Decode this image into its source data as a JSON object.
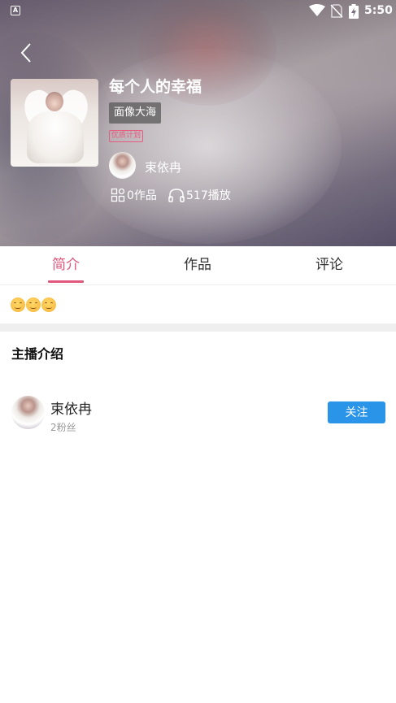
{
  "status_bar": {
    "time": "5:50",
    "icons": [
      "a-icon",
      "wifi-icon",
      "no-sim-icon",
      "battery-charging-icon"
    ]
  },
  "header": {
    "back_icon": "chevron-left-icon",
    "title": "每个人的幸福",
    "category_tag": "面像大海",
    "badge": "优质计划",
    "author_name": "束依冉",
    "works_count": "0作品",
    "plays_count": "517播放"
  },
  "tabs": [
    {
      "label": "简介",
      "active": true
    },
    {
      "label": "作品",
      "active": false
    },
    {
      "label": "评论",
      "active": false
    }
  ],
  "intro": {
    "emoji_count": 3
  },
  "host_section": {
    "title": "主播介绍",
    "name": "束依冉",
    "fans": "2粉丝",
    "follow_label": "关注"
  },
  "colors": {
    "accent": "#e0567c",
    "follow_button": "#2a94e8"
  }
}
